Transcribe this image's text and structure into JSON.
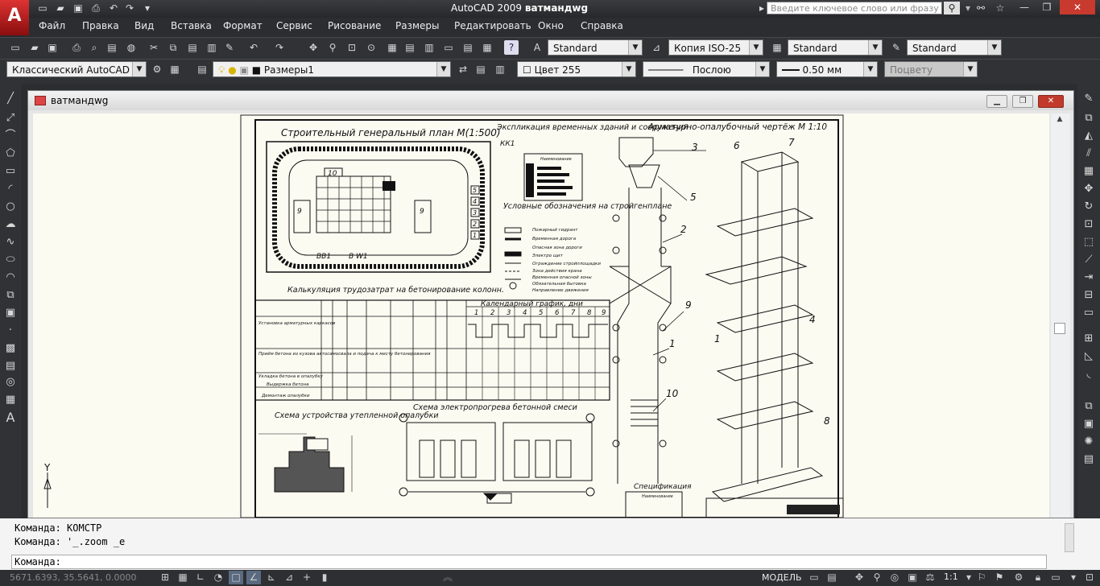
{
  "app": {
    "logo_letter": "A",
    "title_app": "AutoCAD 2009",
    "title_file": "ватмандwg",
    "search_placeholder": "Введите ключевое слово или фразу"
  },
  "menu": [
    "Файл",
    "Правка",
    "Вид",
    "Вставка",
    "Формат",
    "Сервис",
    "Рисование",
    "Размеры",
    "Редактировать",
    "Окно",
    "Справка"
  ],
  "toolbar1": {
    "text_style": "Standard",
    "dim_style": "Копия ISO-25",
    "table_style": "Standard",
    "mleader_style": "Standard"
  },
  "toolbar2": {
    "workspace": "Классический AutoCAD",
    "layer": "Размеры1",
    "color": "Цвет 255",
    "linetype": "Послою",
    "lineweight": "0.50 мм",
    "plotstyle": "Поцвету"
  },
  "drawing_window": {
    "name": "ватмандwg"
  },
  "drawing": {
    "plan_title": "Строительный генеральный план  М(1:500)",
    "explication_title": "Экспликация временных зданий и сооружений",
    "explication_header": "Наименование",
    "legend_title": "Условные обозначения на стройгенплане",
    "legend_items": [
      "Пожарный гидрант",
      "Временная дорога",
      "Опасная зона дороги",
      "Электро щит",
      "Ограждение стройплощадки",
      "Зона действия крана",
      "Временная опасной зоны",
      "Обязательная бытовка",
      "Направление движения"
    ],
    "calc_title": "Калькуляция трудозатрат на бетонирование колонн.",
    "calendar_title": "Календарный график, дни",
    "calendar_days": [
      "1",
      "2",
      "3",
      "4",
      "5",
      "6",
      "7",
      "8",
      "9"
    ],
    "works": [
      "Установка арматурных каркасов",
      "Приём бетона из кузова автосамосвала и подача к месту бетонирования",
      "Укладка бетона в опалубку",
      "Выдержка бетона",
      "Демонтаж опалубки"
    ],
    "formwork_title": "Арматурно-опалубочный чертёж  М 1:10",
    "heat_title": "Схема устройства утепленной опалубки",
    "electro_title": "Схема электропрогрева бетонной смеси",
    "spec_title": "Спецификация",
    "spec_header": "Наименование",
    "labels": [
      "КК1",
      "ВВ1",
      "В W1",
      "10",
      "9",
      "9",
      "5",
      "4",
      "3",
      "2",
      "1"
    ],
    "callouts": [
      "3",
      "5",
      "2",
      "9",
      "1",
      "10",
      "6",
      "7",
      "4",
      "1",
      "8"
    ],
    "axis_y": "Y"
  },
  "command": {
    "history": [
      "Команда: КОМСТР",
      "Команда: '_.zoom _e"
    ],
    "prompt": "Команда:"
  },
  "status": {
    "coords": "5671.6393, 35.5641, 0.0000",
    "model": "МОДЕЛЬ",
    "scale": "1:1"
  }
}
